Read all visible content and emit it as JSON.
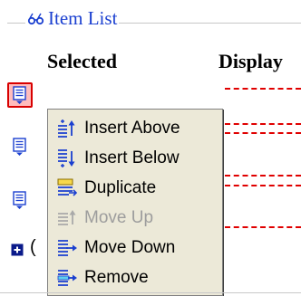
{
  "legend": {
    "title": "Item List",
    "icon": "glasses-icon"
  },
  "columns": {
    "selected": "Selected",
    "display": "Display"
  },
  "rows": [
    {
      "icon": "list-item-icon",
      "active": true
    },
    {
      "icon": "list-item-icon",
      "active": false
    },
    {
      "icon": "list-item-icon",
      "active": false
    }
  ],
  "expand_row": {
    "icon": "plus-box-icon",
    "text": "("
  },
  "context_menu": {
    "items": [
      {
        "label": "Insert Above",
        "icon": "insert-above-icon",
        "enabled": true
      },
      {
        "label": "Insert Below",
        "icon": "insert-below-icon",
        "enabled": true
      },
      {
        "label": "Duplicate",
        "icon": "duplicate-icon",
        "enabled": true
      },
      {
        "label": "Move Up",
        "icon": "move-up-icon",
        "enabled": false
      },
      {
        "label": "Move Down",
        "icon": "move-down-icon",
        "enabled": true
      },
      {
        "label": "Remove",
        "icon": "remove-icon",
        "enabled": true
      }
    ]
  },
  "colors": {
    "title_blue": "#1a3fd0",
    "dash_red": "#e00000",
    "menu_bg": "#ece9d8",
    "active_highlight": "#ffbcbc"
  }
}
